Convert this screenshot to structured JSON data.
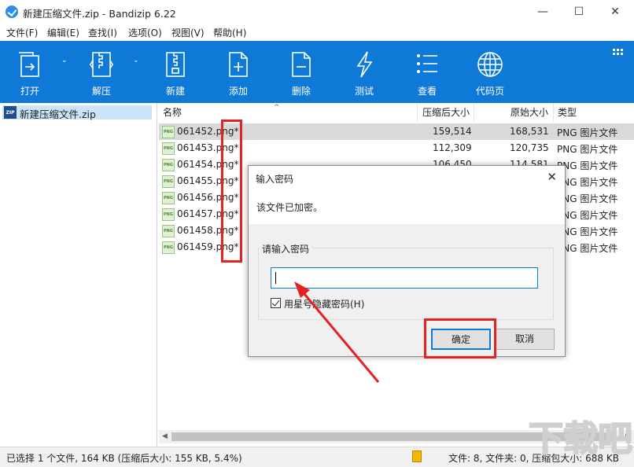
{
  "window": {
    "title": "新建压缩文件.zip - Bandizip 6.22",
    "minimize": "—",
    "maximize": "☐",
    "close": "✕"
  },
  "menu": [
    "文件(F)",
    "编辑(E)",
    "查找(I)",
    "选项(O)",
    "视图(V)",
    "帮助(H)"
  ],
  "toolbar": {
    "open": "打开",
    "extract": "解压",
    "new": "新建",
    "add": "添加",
    "delete": "删除",
    "test": "测试",
    "view": "查看",
    "codepage": "代码页",
    "dropdown_arrow": "⌄"
  },
  "tree": {
    "archive": "新建压缩文件.zip",
    "zip_badge": "ZIP"
  },
  "columns": {
    "name": "名称",
    "packed": "压缩后大小",
    "original": "原始大小",
    "type": "类型",
    "sort_arrow": "^"
  },
  "files": [
    {
      "name": "061452.png*",
      "packed": "159,514",
      "original": "168,531",
      "type": "PNG 图片文件"
    },
    {
      "name": "061453.png*",
      "packed": "112,309",
      "original": "120,735",
      "type": "PNG 图片文件"
    },
    {
      "name": "061454.png*",
      "packed": "106,450",
      "original": "114,581",
      "type": "PNG 图片文件"
    },
    {
      "name": "061455.png*",
      "packed": "",
      "original": "",
      "type": "PNG 图片文件"
    },
    {
      "name": "061456.png*",
      "packed": "",
      "original": "",
      "type": "PNG 图片文件"
    },
    {
      "name": "061457.png*",
      "packed": "",
      "original": "",
      "type": "PNG 图片文件"
    },
    {
      "name": "061458.png*",
      "packed": "",
      "original": "",
      "type": "PNG 图片文件"
    },
    {
      "name": "061459.png*",
      "packed": "",
      "original": "",
      "type": "PNG 图片文件"
    }
  ],
  "png_badge": "PNG",
  "status": {
    "left": "已选择 1 个文件, 164 KB (压缩后大小: 155 KB, 5.4%)",
    "right": "文件: 8, 文件夹: 0, 压缩包大小: 688 KB"
  },
  "dialog": {
    "title": "输入密码",
    "close": "✕",
    "message": "该文件已加密。",
    "group_title": "请输入密码",
    "password_value": "",
    "checkbox_label": "用星号隐藏密码(H)",
    "checkbox_checked": true,
    "ok": "确定",
    "cancel": "取消"
  },
  "watermark": "下载吧",
  "colors": {
    "toolbar": "#0f79d7",
    "highlight": "#e32322",
    "selection": "#d9d9d9"
  }
}
